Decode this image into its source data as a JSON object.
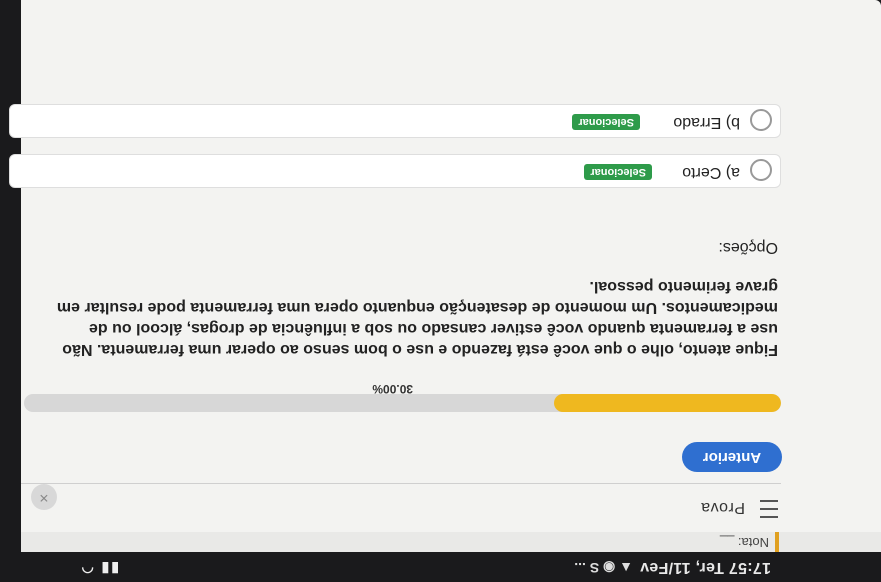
{
  "status_bar": {
    "time": "17:57 Ter, 11/Fev",
    "icons": "▲ ◉ S ...",
    "system_icons": "▮▮ ◠"
  },
  "header": {
    "nota_label": "Nota: __",
    "title": "Prova",
    "close_icon": "×",
    "accent_color": "#e0a020"
  },
  "navigation": {
    "previous_label": "Anterior"
  },
  "progress": {
    "value": 0.3,
    "label": "30.00%",
    "fill_color": "#efb81f"
  },
  "question": {
    "text": "Fique atento, olhe o que você está fazendo e use o bom senso ao operar uma ferramenta. Não use a ferramenta quando você estiver cansado ou sob a influência de drogas, álcool ou de medicamentos. Um momento de desatenção enquanto opera uma ferramenta pode resultar em grave ferimento pessoal."
  },
  "options": {
    "label": "Opções:",
    "items": [
      {
        "text": "a) Certo",
        "select_label": "Selecionar"
      },
      {
        "text": "b) Errado",
        "select_label": "Selecionar"
      }
    ]
  }
}
